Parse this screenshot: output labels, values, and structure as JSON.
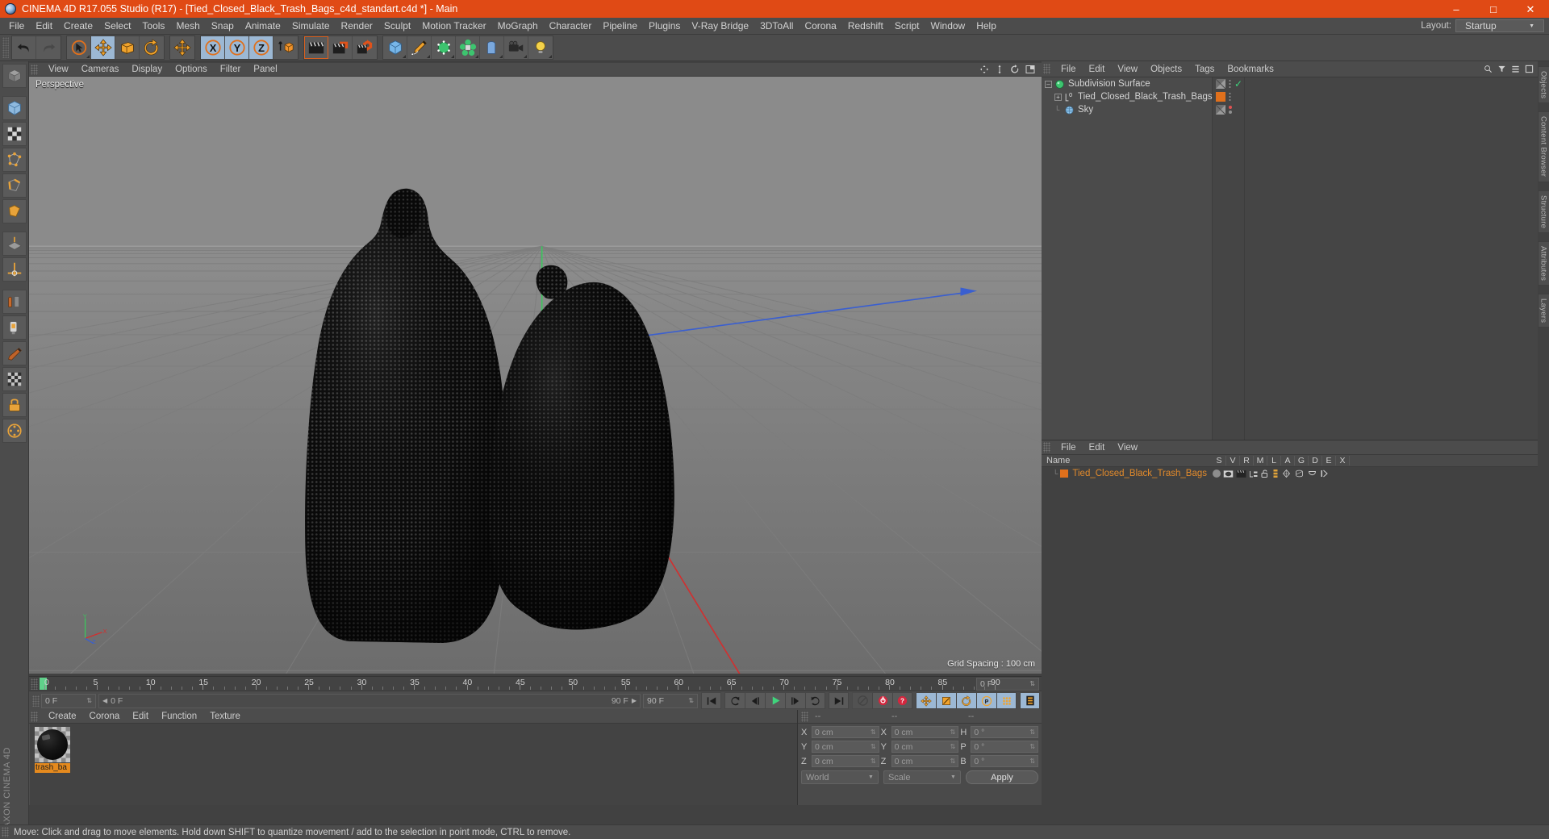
{
  "window": {
    "title": "CINEMA 4D R17.055 Studio (R17) - [Tied_Closed_Black_Trash_Bags_c4d_standart.c4d *] - Main",
    "app_icon": "cinema4d-logo-icon",
    "minimize": "–",
    "maximize": "□",
    "close": "✕"
  },
  "menubar": {
    "items": [
      "File",
      "Edit",
      "Create",
      "Select",
      "Tools",
      "Mesh",
      "Snap",
      "Animate",
      "Simulate",
      "Render",
      "Sculpt",
      "Motion Tracker",
      "MoGraph",
      "Character",
      "Pipeline",
      "Plugins",
      "V-Ray Bridge",
      "3DToAll",
      "Corona",
      "Redshift",
      "Script",
      "Window",
      "Help"
    ],
    "layout_label": "Layout:",
    "layout_value": "Startup"
  },
  "toolbar": {
    "groups": [
      {
        "name": "history",
        "buttons": [
          {
            "name": "undo-button",
            "icon": "undo-arrow-icon"
          },
          {
            "name": "redo-button",
            "icon": "redo-arrow-icon",
            "disabled": true
          }
        ]
      },
      {
        "name": "transform",
        "buttons": [
          {
            "name": "select-tool-button",
            "icon": "cursor-circle-icon"
          },
          {
            "name": "move-tool-button",
            "icon": "move-cross-icon",
            "selected": true
          },
          {
            "name": "scale-tool-button",
            "icon": "scale-box-icon"
          },
          {
            "name": "rotate-tool-button",
            "icon": "rotate-arc-icon"
          }
        ]
      },
      {
        "name": "move-standalone",
        "buttons": [
          {
            "name": "move-alt-button",
            "icon": "move-cross-icon"
          }
        ]
      },
      {
        "name": "axis-locks",
        "buttons": [
          {
            "name": "lock-x-button",
            "icon": "axis-x-icon",
            "selected": true
          },
          {
            "name": "lock-y-button",
            "icon": "axis-y-icon",
            "selected": true
          },
          {
            "name": "lock-z-button",
            "icon": "axis-z-icon",
            "selected": true
          },
          {
            "name": "world-object-coord-button",
            "icon": "world-coordinate-cube-icon"
          }
        ]
      },
      {
        "name": "render",
        "buttons": [
          {
            "name": "render-view-button",
            "icon": "clapper-icon",
            "active": true
          },
          {
            "name": "render-to-picture-viewer-button",
            "icon": "clapper-picture-icon"
          },
          {
            "name": "render-settings-button",
            "icon": "clapper-gear-icon"
          }
        ]
      },
      {
        "name": "create",
        "buttons": [
          {
            "name": "add-cube-button",
            "icon": "cube-primitive-icon"
          },
          {
            "name": "add-spline-button",
            "icon": "pen-spline-icon"
          },
          {
            "name": "add-nurbs-button",
            "icon": "hyper-nurbs-icon"
          },
          {
            "name": "add-array-button",
            "icon": "array-generator-icon"
          },
          {
            "name": "add-bend-button",
            "icon": "bend-deformer-icon"
          },
          {
            "name": "add-camera-button",
            "icon": "camera-icon"
          },
          {
            "name": "add-light-button",
            "icon": "light-bulb-icon"
          }
        ]
      }
    ]
  },
  "leftrail": {
    "buttons": [
      {
        "name": "make-editable-button",
        "icon": "make-editable-icon"
      },
      {
        "name": "model-mode-button",
        "icon": "model-mode-icon"
      },
      {
        "name": "texture-mode-button",
        "icon": "texture-mode-icon"
      },
      {
        "name": "points-mode-button",
        "icon": "points-mode-icon"
      },
      {
        "name": "edges-mode-button",
        "icon": "edges-mode-icon"
      },
      {
        "name": "polygons-mode-button",
        "icon": "polygons-mode-icon"
      },
      {
        "name": "workplane-button",
        "icon": "workplane-icon"
      },
      {
        "name": "enable-axis-button",
        "icon": "axis-modify-icon"
      },
      {
        "name": "viewport-solo-button",
        "icon": "viewport-solo-icon"
      },
      {
        "name": "texture-axis-button",
        "icon": "texture-axis-icon"
      },
      {
        "name": "snap-button",
        "icon": "snap-magnet-icon"
      },
      {
        "name": "quantize-button",
        "icon": "quantize-grid-icon"
      },
      {
        "name": "lock-button",
        "icon": "lock-icon"
      },
      {
        "name": "animation-mode-button",
        "icon": "animation-dots-icon"
      }
    ],
    "brand_line1": "MAXON",
    "brand_line2": "CINEMA 4D"
  },
  "viewport": {
    "menu_items": [
      "View",
      "Cameras",
      "Display",
      "Options",
      "Filter",
      "Panel"
    ],
    "corner_icons": [
      "move-camera-icon",
      "dolly-camera-icon",
      "rotate-camera-icon",
      "maximize-view-icon"
    ],
    "label": "Perspective",
    "grid_spacing": "Grid Spacing : 100 cm",
    "axis_labels": {
      "y": "Y",
      "x": "X",
      "z": "Z"
    },
    "scene_description": "Two tied closed black trash bags rendered as dense point cloud on grey grid floor"
  },
  "timeline": {
    "ticks": [
      "0",
      "5",
      "10",
      "15",
      "20",
      "25",
      "30",
      "35",
      "40",
      "45",
      "50",
      "55",
      "60",
      "65",
      "70",
      "75",
      "80",
      "85",
      "90"
    ],
    "start_frame": "0 F",
    "end_frame": "90 F",
    "current_frame_field": "0 F",
    "preview_min": "0 F",
    "preview_max": "90 F",
    "doc_end_field": "90 F"
  },
  "transport": {
    "buttons": [
      {
        "name": "go-to-start-button",
        "icon": "skip-back-icon"
      },
      {
        "name": "previous-keyframe-button",
        "icon": "prev-key-icon"
      },
      {
        "name": "play-backwards-button",
        "icon": "play-back-icon"
      },
      {
        "name": "play-forwards-button",
        "icon": "play-icon"
      },
      {
        "name": "next-frame-button",
        "icon": "next-frame-icon"
      },
      {
        "name": "next-keyframe-button",
        "icon": "next-key-icon"
      },
      {
        "name": "go-to-end-button",
        "icon": "skip-forward-icon"
      },
      {
        "name": "record-active-objects-button",
        "icon": "record-disc-icon",
        "disabled": true
      },
      {
        "name": "autokeying-button",
        "icon": "autokey-record-icon"
      },
      {
        "name": "keyframe-selection-button",
        "icon": "question-key-icon"
      },
      {
        "name": "position-key-button",
        "icon": "position-key-icon",
        "selected": true
      },
      {
        "name": "scale-key-button",
        "icon": "scale-key-icon",
        "selected": true
      },
      {
        "name": "rotation-key-button",
        "icon": "rotation-key-icon",
        "selected": true
      },
      {
        "name": "parameter-key-button",
        "icon": "parameter-key-icon",
        "selected": true
      },
      {
        "name": "point-level-animation-button",
        "icon": "pla-dots-icon",
        "selected": true
      },
      {
        "name": "timeline-button",
        "icon": "timeline-strip-icon",
        "selected": true
      }
    ]
  },
  "material_manager": {
    "menu_items": [
      "Create",
      "Corona",
      "Edit",
      "Function",
      "Texture"
    ],
    "materials": [
      {
        "name": "trash_ba",
        "preview": "black-glossy-sphere",
        "selected": true
      }
    ]
  },
  "coordinates": {
    "header_cols": [
      "--",
      "--",
      "--"
    ],
    "rows": [
      {
        "axis": "X",
        "position": "0 cm",
        "size_axis": "X",
        "size": "0 cm",
        "rot_axis": "H",
        "rot": "0 °"
      },
      {
        "axis": "Y",
        "position": "0 cm",
        "size_axis": "Y",
        "size": "0 cm",
        "rot_axis": "P",
        "rot": "0 °"
      },
      {
        "axis": "Z",
        "position": "0 cm",
        "size_axis": "Z",
        "size": "0 cm",
        "rot_axis": "B",
        "rot": "0 °"
      }
    ],
    "coord_system": "World",
    "mode": "Scale",
    "apply_label": "Apply"
  },
  "object_manager": {
    "menu_items": [
      "File",
      "Edit",
      "View",
      "Objects",
      "Tags",
      "Bookmarks"
    ],
    "header_icons": [
      "search-icon",
      "filter-icon",
      "collapse-icon",
      "expand-icon"
    ],
    "objects": [
      {
        "name": "Subdivision Surface",
        "icon": "subdivision-surface-icon",
        "indent": 0,
        "expandable": true,
        "tag_color": "#808080",
        "check": "✓"
      },
      {
        "name": "Tied_Closed_Black_Trash_Bags",
        "icon": "polygon-object-icon",
        "indent": 1,
        "expandable": true,
        "tag_color": "#e0701c",
        "check": ""
      },
      {
        "name": "Sky",
        "icon": "sky-object-icon",
        "indent": 0,
        "expandable": false,
        "tag_color": "#808080",
        "check": "•"
      }
    ]
  },
  "material_tag_manager": {
    "menu_items": [
      "File",
      "Edit",
      "View"
    ],
    "name_column": "Name",
    "columns": [
      "S",
      "V",
      "R",
      "M",
      "L",
      "A",
      "G",
      "D",
      "E",
      "X"
    ],
    "rows": [
      {
        "name": "Tied_Closed_Black_Trash_Bags",
        "swatch_color": "#e0701c"
      }
    ]
  },
  "right_tabs": [
    "Objects",
    "Content Browser",
    "Structure",
    "Attributes",
    "Layers"
  ],
  "statusbar": {
    "message": "Move: Click and drag to move elements. Hold down SHIFT to quantize movement / add to the selection in point mode, CTRL to remove."
  },
  "colors": {
    "title_bar": "#e04a15",
    "panel_bg": "#4c4c4c",
    "accent_orange": "#e0701c",
    "selected_blue": "#9cb8d4",
    "material_label": "#e58a1e",
    "axis_x": "#d03030",
    "axis_y": "#35c25b",
    "axis_z": "#3a5fd0"
  }
}
